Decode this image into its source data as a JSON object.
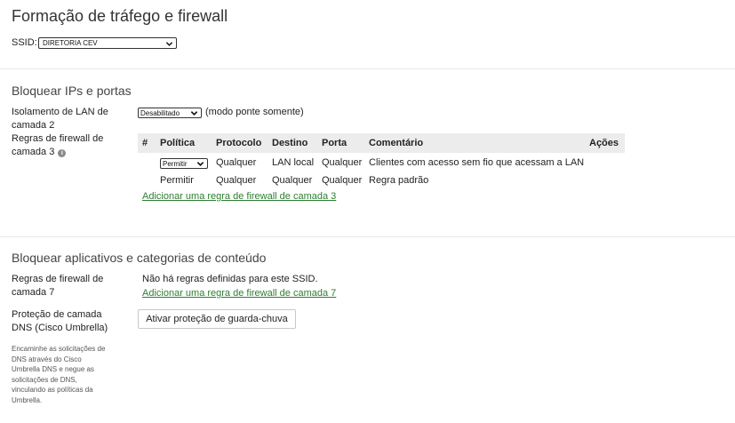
{
  "page": {
    "title": "Formação de tráfego e firewall"
  },
  "ssid": {
    "label": "SSID:",
    "selected": "DIRETORIA CEV"
  },
  "block_ips": {
    "title": "Bloquear IPs e portas",
    "lan_isolation": {
      "label": "Isolamento de LAN de camada 2",
      "selected": "Desabilitado",
      "note": "(modo ponte somente)"
    },
    "l3_rules": {
      "label": "Regras de firewall de camada 3",
      "info_icon": "info-icon",
      "columns": [
        "#",
        "Política",
        "Protocolo",
        "Destino",
        "Porta",
        "Comentário",
        "Ações"
      ],
      "rows": [
        {
          "policy": "Permitir",
          "protocol": "Qualquer",
          "destination": "LAN local",
          "port": "Qualquer",
          "comment": "Clientes com acesso sem fio que acessam a LAN"
        },
        {
          "policy": "Permitir",
          "protocol": "Qualquer",
          "destination": "Qualquer",
          "port": "Qualquer",
          "comment": "Regra padrão"
        }
      ],
      "add_link": "Adicionar uma regra de firewall de camada 3"
    }
  },
  "block_apps": {
    "title": "Bloquear aplicativos e categorias de conteúdo",
    "l7_rules": {
      "label": "Regras de firewall de camada 7",
      "empty_text": "Não há regras definidas para este SSID.",
      "add_link": "Adicionar uma regra de firewall de camada 7"
    },
    "dns": {
      "label": "Proteção de camada DNS (Cisco Umbrella)",
      "button": "Ativar proteção de guarda-chuva",
      "help": "Encaminhe as solicitações de DNS através do Cisco Umbrella DNS e negue as solicitações de DNS, vinculando as políticas da Umbrella."
    }
  },
  "colors": {
    "link": "#2e7d32",
    "header_bg": "#ececec",
    "divider": "#e6e6e6"
  }
}
